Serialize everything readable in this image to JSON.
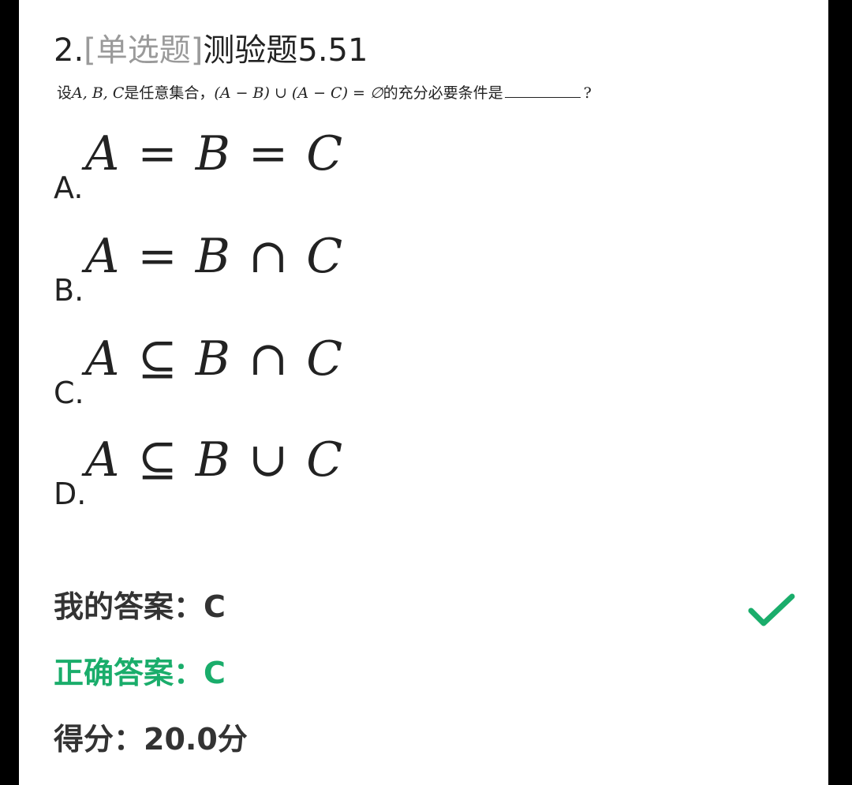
{
  "question": {
    "number": "2.",
    "type_tag": "[单选题]",
    "title": "测验题5.51",
    "stem_prefix": "设",
    "stem_vars": "A, B, C",
    "stem_middle": "是任意集合，",
    "stem_expr": "(A − B) ∪ (A − C) = ∅",
    "stem_suffix": "的充分必要条件是",
    "stem_end": "?"
  },
  "options": [
    {
      "letter": "A.",
      "formula": "A = B = C"
    },
    {
      "letter": "B.",
      "formula": "A = B ∩ C"
    },
    {
      "letter": "C.",
      "formula": "A ⊆ B ∩ C"
    },
    {
      "letter": "D.",
      "formula": "A ⊆ B ∪ C"
    }
  ],
  "result": {
    "my_answer_label": "我的答案：",
    "my_answer": "C",
    "correct_answer_label": "正确答案：",
    "correct_answer": "C",
    "score_label": "得分：",
    "score": "20.0分",
    "status_icon": "checkmark-icon",
    "accent_color": "#1aad6b"
  }
}
